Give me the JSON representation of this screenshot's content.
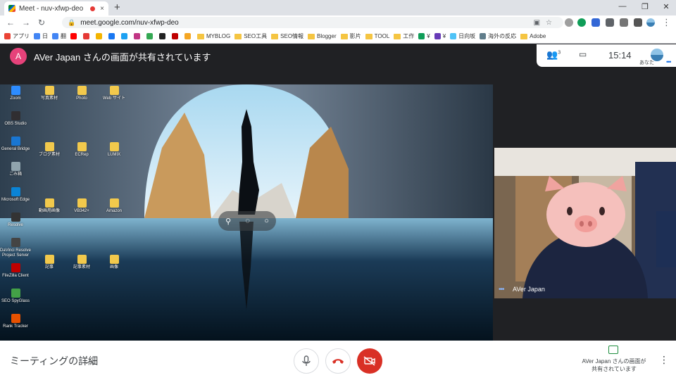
{
  "browser": {
    "tab_title": "Meet - nuv-xfwp-deo",
    "tab_close": "×",
    "new_tab": "+",
    "win_min": "—",
    "win_restore": "❐",
    "win_close": "✕",
    "back": "←",
    "forward": "→",
    "reload": "↻",
    "url": "meet.google.com/nuv-xfwp-deo",
    "omnibox_right": "▣☆",
    "menu": "⋮"
  },
  "bookmarks": [
    {
      "label": "アプリ",
      "color": "#ea4335"
    },
    {
      "label": "日",
      "color": "#4285f4"
    },
    {
      "label": "翻",
      "color": "#4285f4"
    },
    {
      "label": "",
      "color": "#ff0000"
    },
    {
      "label": "",
      "color": "#e53935"
    },
    {
      "label": "",
      "color": "#f4b400"
    },
    {
      "label": "",
      "color": "#1877f2"
    },
    {
      "label": "",
      "color": "#1da1f2"
    },
    {
      "label": "",
      "color": "#c13584"
    },
    {
      "label": "",
      "color": "#34a853"
    },
    {
      "label": "",
      "color": "#222"
    },
    {
      "label": "",
      "color": "#bf0000"
    },
    {
      "label": "",
      "color": "#f5a623"
    },
    {
      "label": "MYBLOG",
      "folder": true
    },
    {
      "label": "SEO工具",
      "folder": true
    },
    {
      "label": "SEO情報",
      "folder": true
    },
    {
      "label": "Blogger",
      "folder": true
    },
    {
      "label": "影片",
      "folder": true
    },
    {
      "label": "TOOL",
      "folder": true
    },
    {
      "label": "工作",
      "folder": true
    },
    {
      "label": "¥",
      "color": "#0f9d58"
    },
    {
      "label": "¥",
      "color": "#673ab7"
    },
    {
      "label": "日向坂",
      "color": "#4fc3f7"
    },
    {
      "label": "海外の反応",
      "color": "#607d8b"
    },
    {
      "label": "Adobe",
      "folder": true
    }
  ],
  "meet": {
    "presenter_initial": "A",
    "presenter_banner": "AVer Japan さんの画面が共有されています",
    "participants_count": "3",
    "time": "15:14",
    "self_label": "あなた",
    "tile_name": "AVer Japan",
    "details_label": "ミーティングの詳細",
    "present_status_line1": "AVer Japan さんの画面が",
    "present_status_line2": "共有されています",
    "colors": {
      "accent": "#1a73e8",
      "hangup": "#d93025",
      "avatar": "#e6427a",
      "present": "#1e8e3e"
    }
  },
  "desktop_icons": [
    {
      "label": "Zoom",
      "color": "#2d8cff"
    },
    {
      "label": "OBS Studio",
      "color": "#302e31"
    },
    {
      "label": "General Bridge",
      "color": "#1976d2"
    },
    {
      "label": "ごみ箱",
      "color": "#90a4ae"
    },
    {
      "label": "Microsoft Edge",
      "color": "#0a84d6"
    },
    {
      "label": "Resolve",
      "color": "#333"
    },
    {
      "label": "DaVinci Resolve Project Server",
      "color": "#444"
    },
    {
      "label": "FileZilla Client",
      "color": "#bf0000"
    },
    {
      "label": "SEO SpyGlass",
      "color": "#43a047"
    },
    {
      "label": "Rank Tracker",
      "color": "#e65100"
    }
  ],
  "desktop_files": [
    "写真素材",
    "Photo",
    "Web サイト",
    "ブログ素材",
    "ECRep",
    "LUMIX",
    "動画用画像",
    "VB342+",
    "Amazon",
    "記事",
    "記事素材",
    "画像"
  ]
}
